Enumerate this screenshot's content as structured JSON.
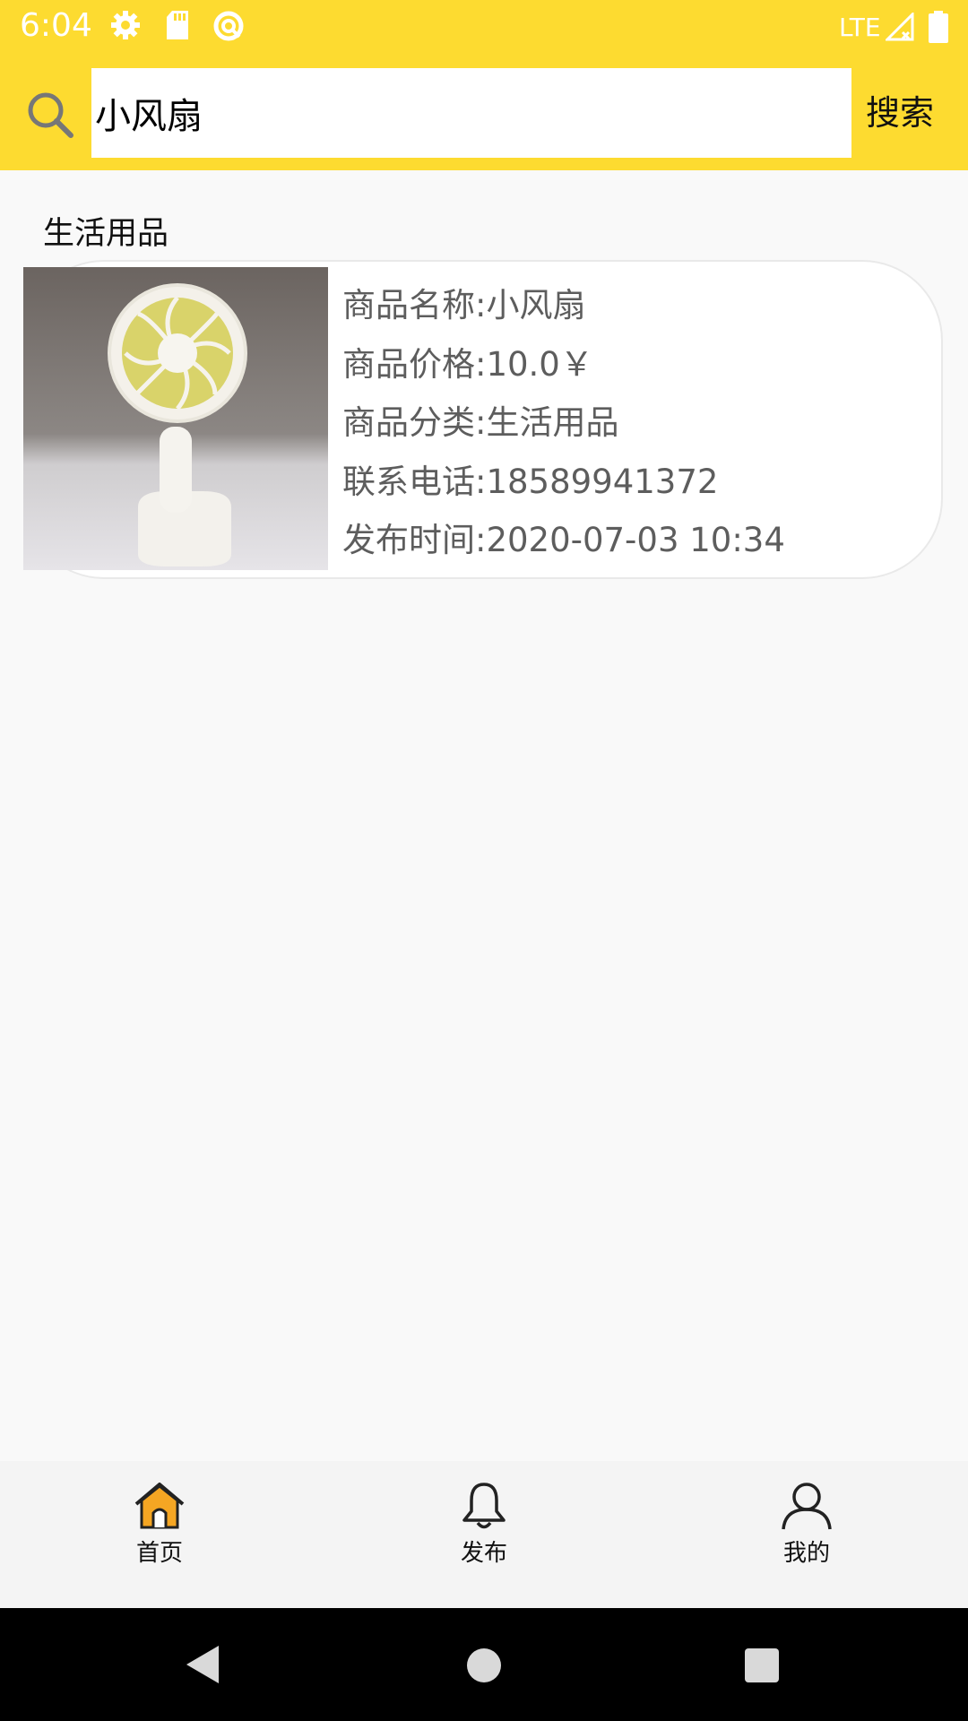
{
  "status_bar": {
    "time": "6:04",
    "network": "LTE",
    "icons": [
      "gear-icon",
      "sd-card-icon",
      "sync-icon",
      "signal-icon",
      "battery-icon"
    ]
  },
  "search": {
    "query": "小风扇",
    "button_label": "搜索",
    "icon": "search-icon"
  },
  "section": {
    "title": "生活用品"
  },
  "product": {
    "image": "fan-photo",
    "name_line": "商品名称:小风扇",
    "price_line": "商品价格:10.0￥",
    "category_line": "商品分类:生活用品",
    "phone_line": "联系电话:18589941372",
    "time_line": "发布时间:2020-07-03 10:34"
  },
  "bottom_nav": {
    "items": [
      {
        "label": "首页",
        "icon": "home-icon",
        "active": true
      },
      {
        "label": "发布",
        "icon": "bell-icon",
        "active": false
      },
      {
        "label": "我的",
        "icon": "user-icon",
        "active": false
      }
    ]
  },
  "system_nav": {
    "icons": [
      "back-icon",
      "home-circle-icon",
      "recents-icon"
    ]
  },
  "colors": {
    "accent": "#fddb30",
    "background": "#f9f9f9",
    "text_muted": "#5d5d5d",
    "home_icon_fill": "#f5a623"
  }
}
